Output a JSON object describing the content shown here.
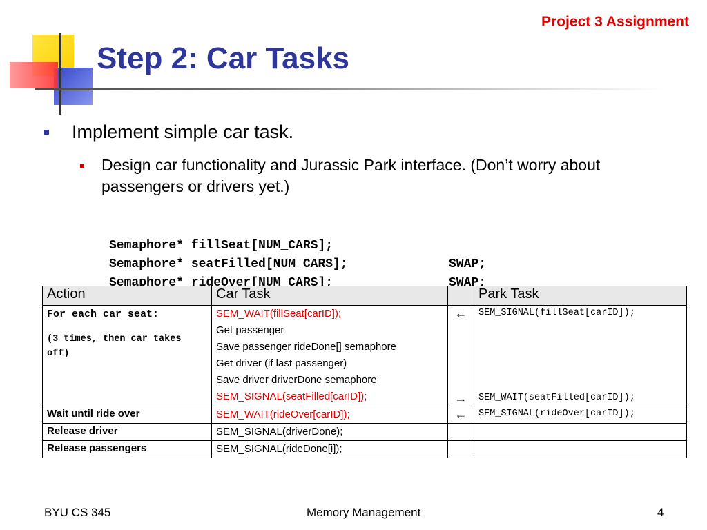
{
  "header": {
    "corner_label": "Project 3 Assignment",
    "title": "Step 2: Car Tasks"
  },
  "bullets": {
    "level1": "Implement simple car task.",
    "level2": "Design car functionality and Jurassic Park interface.  (Don’t worry about passengers or drivers yet.)"
  },
  "code_lines": [
    {
      "decl": "Semaphore* fillSeat[NUM_CARS];",
      "value": "SWAP;"
    },
    {
      "decl": "Semaphore* seatFilled[NUM_CARS];",
      "value": "SWAP;"
    },
    {
      "decl": "Semaphore* rideOver[NUM_CARS];",
      "value": "SWAP;"
    }
  ],
  "table": {
    "headers": {
      "action": "Action",
      "car": "Car Task",
      "arrow": "",
      "park": "Park Task"
    },
    "row1": {
      "action_main": "For each car seat:",
      "action_note": "(3 times, then car takes off)",
      "car_lines": [
        "SEM_WAIT(fillSeat[carID]);",
        "Get passenger",
        "Save passenger rideDone[] semaphore",
        "Get driver (if last passenger)",
        "Save driver driverDone semaphore",
        "SEM_SIGNAL(seatFilled[carID]);"
      ],
      "arrow_top": "←",
      "arrow_bottom": "→",
      "park_top": "SEM_SIGNAL(fillSeat[carID]);",
      "park_bottom": "SEM_WAIT(seatFilled[carID]);"
    },
    "row2": {
      "action": "Wait until ride over",
      "car": "SEM_WAIT(rideOver[carID]);",
      "arrow": "←",
      "park": "SEM_SIGNAL(rideOver[carID]);"
    },
    "row3": {
      "action": "Release driver",
      "car": "SEM_SIGNAL(driverDone);",
      "arrow": "",
      "park": ""
    },
    "row4": {
      "action": "Release passengers",
      "car": "SEM_SIGNAL(rideDone[i]);",
      "arrow": "",
      "park": ""
    }
  },
  "footer": {
    "left": "BYU CS 345",
    "center": "Memory Management",
    "right": "4"
  },
  "colors": {
    "title": "#2f3699",
    "red_text": "#e00000",
    "deco_yellow": "#ffd800",
    "deco_blue": "#3347cc",
    "deco_red": "#ff3030"
  }
}
